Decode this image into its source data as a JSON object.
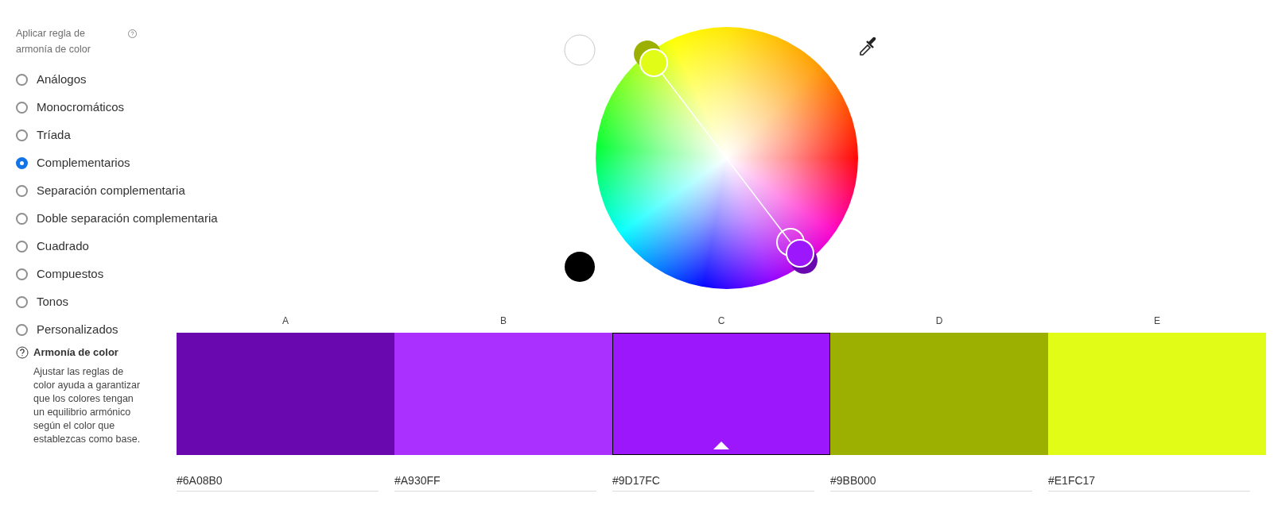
{
  "sidebar": {
    "title": "Aplicar regla de armonía de color",
    "rules": [
      {
        "label": "Análogos",
        "selected": false
      },
      {
        "label": "Monocromáticos",
        "selected": false
      },
      {
        "label": "Tríada",
        "selected": false
      },
      {
        "label": "Complementarios",
        "selected": true
      },
      {
        "label": "Separación complementaria",
        "selected": false
      },
      {
        "label": "Doble separación complementaria",
        "selected": false
      },
      {
        "label": "Cuadrado",
        "selected": false
      },
      {
        "label": "Compuestos",
        "selected": false
      },
      {
        "label": "Tonos",
        "selected": false
      },
      {
        "label": "Personalizados",
        "selected": false
      }
    ],
    "help": {
      "title": "Armonía de color",
      "text": "Ajustar las reglas de color ayuda a garantizar que los colores tengan un equilibrio armónico según el color que establezcas como base."
    }
  },
  "swatches": [
    {
      "label": "A",
      "color": "#6a08b0",
      "hex": "#6A08B0",
      "selected": false
    },
    {
      "label": "B",
      "color": "#a930ff",
      "hex": "#A930FF",
      "selected": false
    },
    {
      "label": "C",
      "color": "#9d17fc",
      "hex": "#9D17FC",
      "selected": true
    },
    {
      "label": "D",
      "color": "#9bb000",
      "hex": "#9BB000",
      "selected": false
    },
    {
      "label": "E",
      "color": "#e1fc17",
      "hex": "#E1FC17",
      "selected": false
    }
  ]
}
